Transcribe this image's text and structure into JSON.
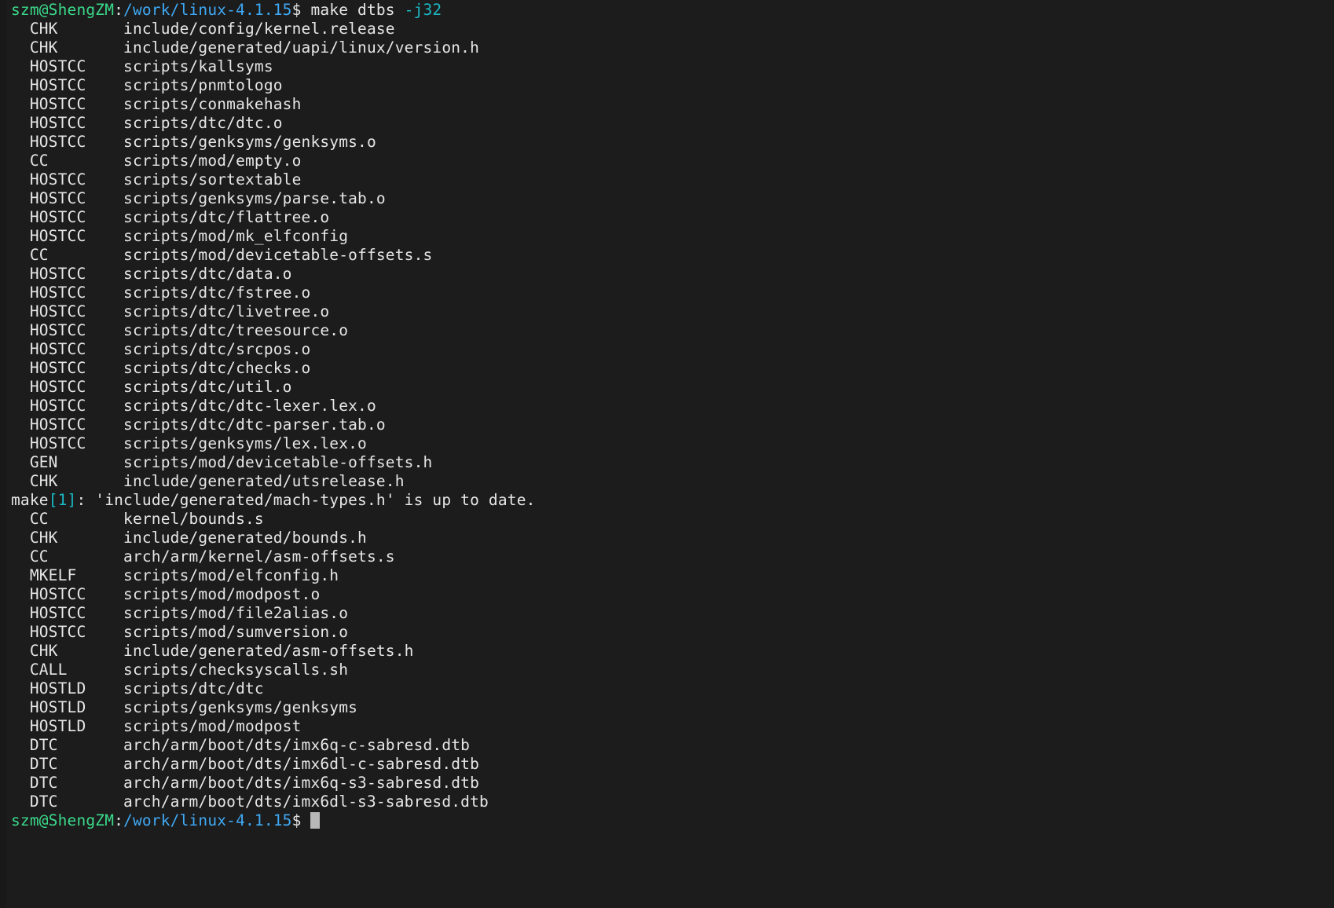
{
  "terminal": {
    "background_color": "#1c1c1c",
    "foreground_color": "#e6e6e6",
    "prompt": {
      "user_host": "szm@ShengZM",
      "colon": ":",
      "path": "/work/linux-4.1.15",
      "dollar": "$",
      "user_host_color": "#3ad98a",
      "path_color": "#3fa9f5"
    },
    "command": {
      "name": " make dtbs ",
      "flag": "-j32",
      "flag_color": "#1bb8c4"
    },
    "build_lines": [
      {
        "tag": "CHK",
        "target": "include/config/kernel.release"
      },
      {
        "tag": "CHK",
        "target": "include/generated/uapi/linux/version.h"
      },
      {
        "tag": "HOSTCC",
        "target": "scripts/kallsyms"
      },
      {
        "tag": "HOSTCC",
        "target": "scripts/pnmtologo"
      },
      {
        "tag": "HOSTCC",
        "target": "scripts/conmakehash"
      },
      {
        "tag": "HOSTCC",
        "target": "scripts/dtc/dtc.o"
      },
      {
        "tag": "HOSTCC",
        "target": "scripts/genksyms/genksyms.o"
      },
      {
        "tag": "CC",
        "target": "scripts/mod/empty.o"
      },
      {
        "tag": "HOSTCC",
        "target": "scripts/sortextable"
      },
      {
        "tag": "HOSTCC",
        "target": "scripts/genksyms/parse.tab.o"
      },
      {
        "tag": "HOSTCC",
        "target": "scripts/dtc/flattree.o"
      },
      {
        "tag": "HOSTCC",
        "target": "scripts/mod/mk_elfconfig"
      },
      {
        "tag": "CC",
        "target": "scripts/mod/devicetable-offsets.s"
      },
      {
        "tag": "HOSTCC",
        "target": "scripts/dtc/data.o"
      },
      {
        "tag": "HOSTCC",
        "target": "scripts/dtc/fstree.o"
      },
      {
        "tag": "HOSTCC",
        "target": "scripts/dtc/livetree.o"
      },
      {
        "tag": "HOSTCC",
        "target": "scripts/dtc/treesource.o"
      },
      {
        "tag": "HOSTCC",
        "target": "scripts/dtc/srcpos.o"
      },
      {
        "tag": "HOSTCC",
        "target": "scripts/dtc/checks.o"
      },
      {
        "tag": "HOSTCC",
        "target": "scripts/dtc/util.o"
      },
      {
        "tag": "HOSTCC",
        "target": "scripts/dtc/dtc-lexer.lex.o"
      },
      {
        "tag": "HOSTCC",
        "target": "scripts/dtc/dtc-parser.tab.o"
      },
      {
        "tag": "HOSTCC",
        "target": "scripts/genksyms/lex.lex.o"
      },
      {
        "tag": "GEN",
        "target": "scripts/mod/devicetable-offsets.h"
      },
      {
        "tag": "CHK",
        "target": "include/generated/utsrelease.h"
      }
    ],
    "make_message": {
      "prefix": "make",
      "bracket": "[1]",
      "suffix": ": 'include/generated/mach-types.h' is up to date."
    },
    "build_lines_2": [
      {
        "tag": "CC",
        "target": "kernel/bounds.s"
      },
      {
        "tag": "CHK",
        "target": "include/generated/bounds.h"
      },
      {
        "tag": "CC",
        "target": "arch/arm/kernel/asm-offsets.s"
      },
      {
        "tag": "MKELF",
        "target": "scripts/mod/elfconfig.h"
      },
      {
        "tag": "HOSTCC",
        "target": "scripts/mod/modpost.o"
      },
      {
        "tag": "HOSTCC",
        "target": "scripts/mod/file2alias.o"
      },
      {
        "tag": "HOSTCC",
        "target": "scripts/mod/sumversion.o"
      },
      {
        "tag": "CHK",
        "target": "include/generated/asm-offsets.h"
      },
      {
        "tag": "CALL",
        "target": "scripts/checksyscalls.sh"
      },
      {
        "tag": "HOSTLD",
        "target": "scripts/dtc/dtc"
      },
      {
        "tag": "HOSTLD",
        "target": "scripts/genksyms/genksyms"
      },
      {
        "tag": "HOSTLD",
        "target": "scripts/mod/modpost"
      },
      {
        "tag": "DTC",
        "target": "arch/arm/boot/dts/imx6q-c-sabresd.dtb"
      },
      {
        "tag": "DTC",
        "target": "arch/arm/boot/dts/imx6dl-c-sabresd.dtb"
      },
      {
        "tag": "DTC",
        "target": "arch/arm/boot/dts/imx6q-s3-sabresd.dtb"
      },
      {
        "tag": "DTC",
        "target": "arch/arm/boot/dts/imx6dl-s3-sabresd.dtb"
      }
    ],
    "cursor": {
      "color": "#b8b8b8",
      "glyph": ""
    }
  }
}
